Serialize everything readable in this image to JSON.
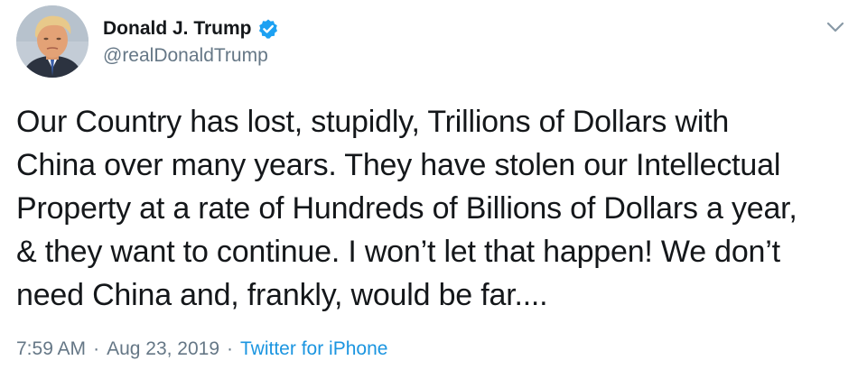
{
  "tweet": {
    "author": {
      "display_name": "Donald J. Trump",
      "handle": "@realDonaldTrump",
      "verified_icon": "verified-badge-icon",
      "avatar_icon": "avatar"
    },
    "menu_icon": "chevron-down-icon",
    "text": "Our Country has lost, stupidly, Trillions of Dollars with\nChina over many years. They have stolen our Intellectual\nProperty at a rate of Hundreds of Billions of Dollars a year,\n& they want to continue. I won’t let that happen! We don’t\nneed China and, frankly, would be far....",
    "time": "7:59 AM",
    "separator": "·",
    "date": "Aug 23, 2019",
    "source": "Twitter for iPhone"
  },
  "colors": {
    "text": "#14171a",
    "secondary": "#657786",
    "link": "#1b95e0",
    "verified": "#1da1f2"
  }
}
